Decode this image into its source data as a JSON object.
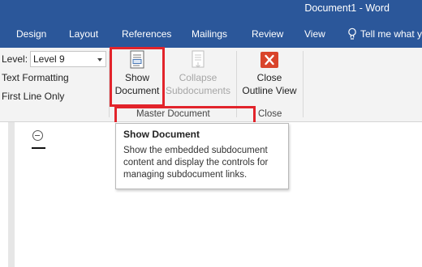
{
  "window": {
    "title": "Document1 - Word"
  },
  "tabs": [
    "Design",
    "Layout",
    "References",
    "Mailings",
    "Review",
    "View"
  ],
  "tell_me": {
    "label": "Tell me what y"
  },
  "outline_tools": {
    "level_label": "Level:",
    "level_value": "Level 9",
    "text_formatting_label": "Text Formatting",
    "first_line_only_label": "First Line Only"
  },
  "master_document": {
    "show_document": {
      "line1": "Show",
      "line2": "Document",
      "icon": "show-document-icon"
    },
    "collapse_subdocuments": {
      "line1": "Collapse",
      "line2": "Subdocuments",
      "icon": "collapse-subdocuments-icon",
      "enabled": false
    },
    "group_label": "Master Document"
  },
  "close_group": {
    "close_outline_view": {
      "line1": "Close",
      "line2": "Outline View",
      "icon": "close-x-icon"
    },
    "group_label": "Close"
  },
  "tooltip": {
    "title": "Show Document",
    "body": "Show the embedded subdocument content and display the controls for managing subdocument links."
  },
  "colors": {
    "ribbon_blue": "#2b579a",
    "highlight_red": "#e2242b",
    "close_icon_red": "#d9442b"
  }
}
